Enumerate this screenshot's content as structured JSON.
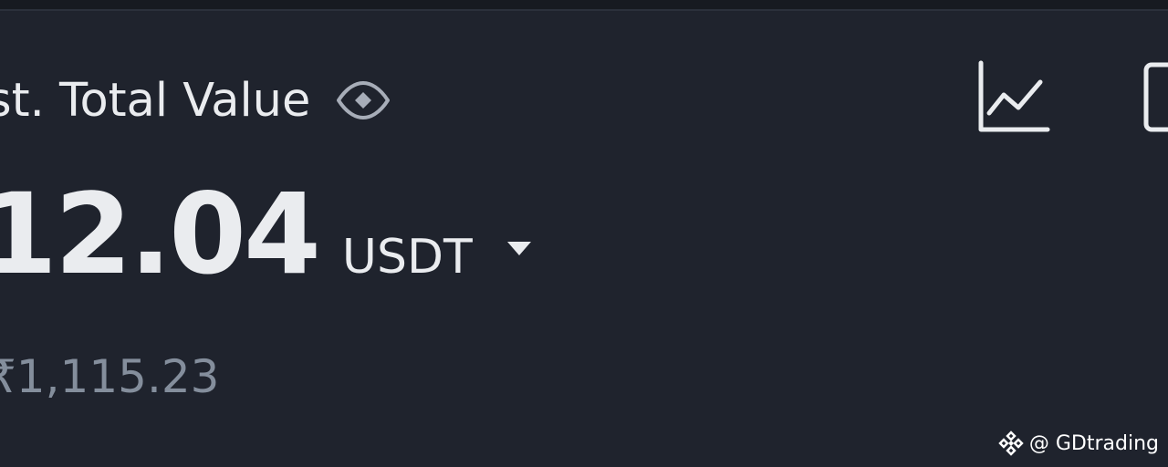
{
  "header": {
    "label": "st. Total Value"
  },
  "balance": {
    "amount": "12.04",
    "currency": "USDT",
    "fiat_value": "₹1,115.23"
  },
  "icons": {
    "visibility": "eye-icon",
    "chart": "line-chart-icon",
    "dropdown": "caret-down-icon",
    "partial": "document-icon"
  },
  "watermark": {
    "text": "@ GDtrading"
  },
  "colors": {
    "background": "#1f232d",
    "primary_text": "#eaecef",
    "secondary_text": "#848e9c",
    "icon": "#a7adb8"
  }
}
